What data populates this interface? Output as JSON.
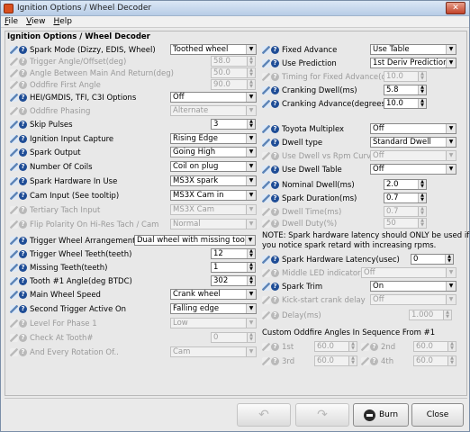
{
  "window": {
    "title": "Ignition Options / Wheel Decoder",
    "close": "✕"
  },
  "menu": [
    "File",
    "View",
    "Help"
  ],
  "panel_title": "Ignition Options / Wheel Decoder",
  "left": [
    {
      "label": "Spark Mode (Dizzy, EDIS, Wheel)",
      "control": "select",
      "value": "Toothed wheel",
      "enabled": true
    },
    {
      "label": "Trigger Angle/Offset(deg)",
      "control": "spin",
      "value": "58.0",
      "enabled": false
    },
    {
      "label": "Angle Between Main And Return(deg)",
      "control": "spin",
      "value": "50.0",
      "enabled": false
    },
    {
      "label": "Oddfire First Angle",
      "control": "spin",
      "value": "90.0",
      "enabled": false
    },
    {
      "label": "HEI/GMDIS, TFI, C3I Options",
      "control": "select",
      "value": "Off",
      "enabled": true
    },
    {
      "label": "Oddfire Phasing",
      "control": "select",
      "value": "Alternate",
      "enabled": false
    },
    {
      "label": "Skip Pulses",
      "control": "spin",
      "value": "3",
      "enabled": true
    },
    {
      "label": "Ignition Input Capture",
      "control": "select",
      "value": "Rising Edge",
      "enabled": true
    },
    {
      "label": "Spark Output",
      "control": "select",
      "value": "Going High",
      "enabled": true
    },
    {
      "label": "Number Of Coils",
      "control": "select",
      "value": "Coil on plug",
      "enabled": true
    },
    {
      "label": "Spark Hardware In Use",
      "control": "select",
      "value": "MS3X spark",
      "enabled": true
    },
    {
      "label": "Cam Input (See tooltip)",
      "control": "select",
      "value": "MS3X Cam in",
      "enabled": true
    },
    {
      "label": "Tertiary Tach Input",
      "control": "select",
      "value": "MS3X Cam",
      "enabled": false
    },
    {
      "label": "Flip Polarity On Hi-Res Tach / Cam",
      "control": "select",
      "value": "Normal",
      "enabled": false
    },
    {
      "label": "Trigger Wheel Arrangement",
      "control": "select",
      "value": "Dual wheel with missing tooth",
      "enabled": true
    },
    {
      "label": "Trigger Wheel Teeth(teeth)",
      "control": "spin",
      "value": "12",
      "enabled": true
    },
    {
      "label": "Missing Teeth(teeth)",
      "control": "spin",
      "value": "1",
      "enabled": true
    },
    {
      "label": "Tooth #1 Angle(deg BTDC)",
      "control": "spin",
      "value": "302",
      "enabled": true
    },
    {
      "label": "Main Wheel Speed",
      "control": "select",
      "value": "Crank wheel",
      "enabled": true
    },
    {
      "label": "Second Trigger Active On",
      "control": "select",
      "value": "Falling edge",
      "enabled": true
    },
    {
      "label": "Level For Phase 1",
      "control": "select",
      "value": "Low",
      "enabled": false
    },
    {
      "label": "Check At Tooth#",
      "control": "spin",
      "value": "0",
      "enabled": false
    },
    {
      "label": "And Every Rotation Of..",
      "control": "select",
      "value": "Cam",
      "enabled": false
    }
  ],
  "right": [
    {
      "label": "Fixed Advance",
      "control": "select",
      "value": "Use Table",
      "enabled": true
    },
    {
      "label": "Use Prediction",
      "control": "select",
      "value": "1st Deriv Prediction",
      "enabled": true
    },
    {
      "label": "Timing for Fixed Advance(degrees)",
      "control": "spin",
      "value": "10.0",
      "enabled": false
    },
    {
      "label": "Cranking Dwell(ms)",
      "control": "spin",
      "value": "5.8",
      "enabled": true
    },
    {
      "label": "Cranking Advance(degrees)",
      "control": "spin",
      "value": "10.0",
      "enabled": true
    },
    {
      "label": "Toyota Multiplex",
      "control": "select",
      "value": "Off",
      "enabled": true
    },
    {
      "label": "Dwell type",
      "control": "select",
      "value": "Standard Dwell",
      "enabled": true
    },
    {
      "label": "Use Dwell vs Rpm Curve",
      "control": "select",
      "value": "Off",
      "enabled": false
    },
    {
      "label": "Use Dwell Table",
      "control": "select",
      "value": "Off",
      "enabled": true
    },
    {
      "label": "Nominal Dwell(ms)",
      "control": "spin",
      "value": "2.0",
      "enabled": true
    },
    {
      "label": "Spark Duration(ms)",
      "control": "spin",
      "value": "0.7",
      "enabled": true
    },
    {
      "label": "Dwell Time(ms)",
      "control": "spin",
      "value": "0.7",
      "enabled": false
    },
    {
      "label": "Dwell Duty(%)",
      "control": "spin",
      "value": "50",
      "enabled": false
    },
    {
      "label": "Spark Hardware Latency(usec)",
      "control": "spin",
      "value": "0",
      "enabled": true
    },
    {
      "label": "Middle LED indicator",
      "control": "select",
      "value": "Off",
      "enabled": false
    },
    {
      "label": "Spark Trim",
      "control": "select",
      "value": "On",
      "enabled": true
    },
    {
      "label": "Kick-start crank delay",
      "control": "select",
      "value": "Off",
      "enabled": false
    },
    {
      "label": "Delay(ms)",
      "control": "spin",
      "value": "1.000",
      "enabled": false
    }
  ],
  "note_lines": [
    "NOTE: Spark hardware latency should ONLY be used if",
    "you notice spark retard with increasing rpms."
  ],
  "oddfire_title": "Custom Oddfire Angles In Sequence From #1",
  "oddfire": [
    {
      "label": "1st",
      "value": "60.0"
    },
    {
      "label": "2nd",
      "value": "60.0"
    },
    {
      "label": "3rd",
      "value": "60.0"
    },
    {
      "label": "4th",
      "value": "60.0"
    }
  ],
  "buttons": {
    "burn": "Burn",
    "close": "Close"
  }
}
